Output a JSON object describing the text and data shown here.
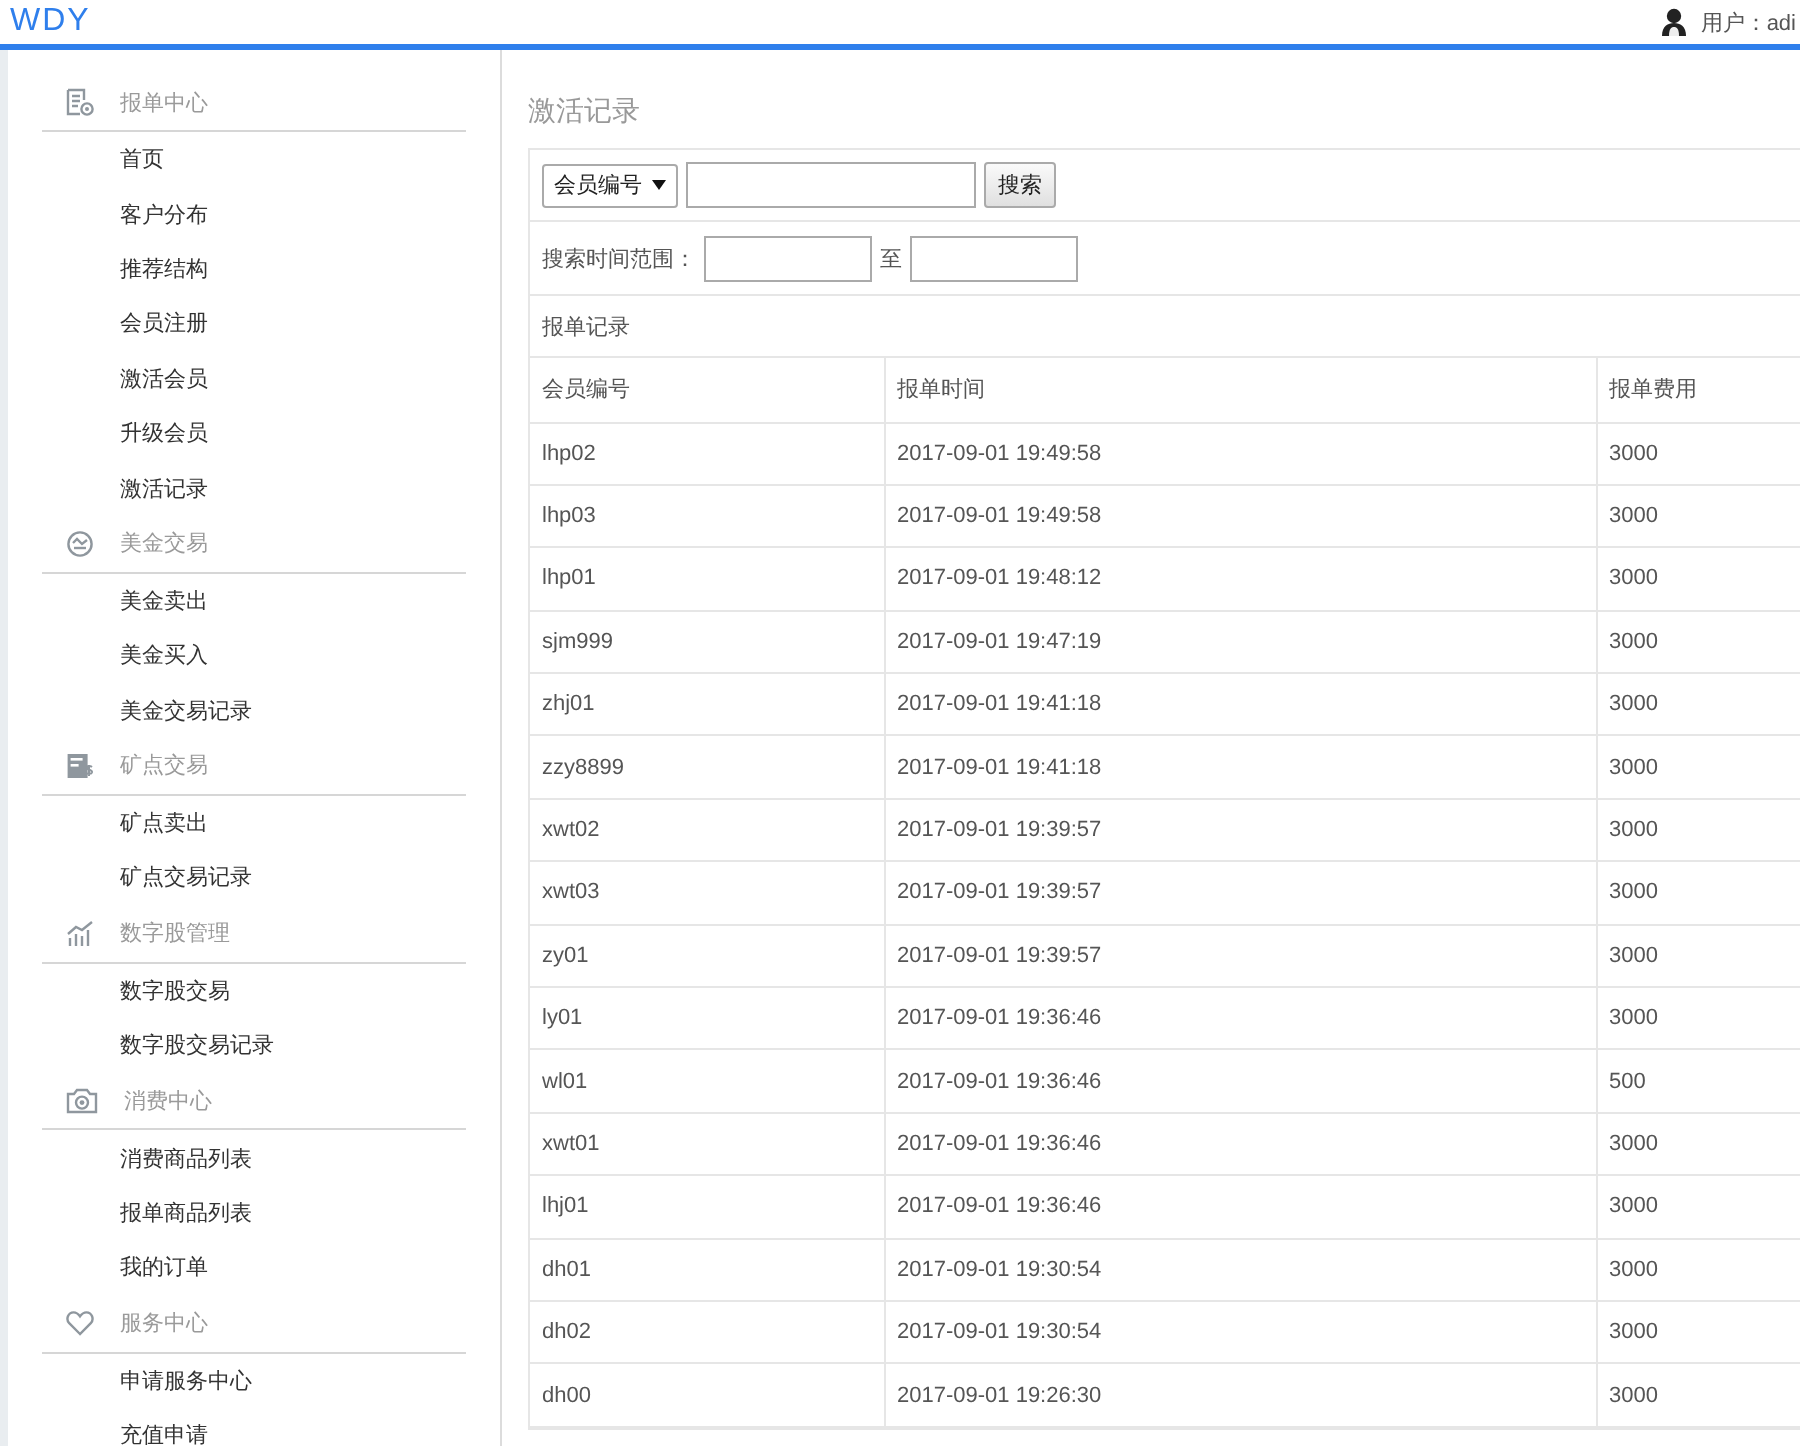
{
  "header": {
    "logo": "WDY",
    "user": "用户：adi"
  },
  "sidebar": {
    "sections": [
      {
        "kind": "report",
        "title": "报单中心",
        "items": [
          "首页",
          "客户分布",
          "推荐结构",
          "会员注册",
          "激活会员",
          "升级会员",
          "激活记录"
        ]
      },
      {
        "kind": "exchange",
        "title": "美金交易",
        "items": [
          "美金卖出",
          "美金买入",
          "美金交易记录"
        ]
      },
      {
        "kind": "mining",
        "title": "矿点交易",
        "items": [
          "矿点卖出",
          "矿点交易记录"
        ]
      },
      {
        "kind": "stock",
        "title": "数字股管理",
        "items": [
          "数字股交易",
          "数字股交易记录"
        ]
      },
      {
        "kind": "consume",
        "title": "消费中心",
        "items": [
          "消费商品列表",
          "报单商品列表",
          "我的订单"
        ]
      },
      {
        "kind": "service",
        "title": "服务中心",
        "items": [
          "申请服务中心",
          "充值申请"
        ]
      }
    ]
  },
  "page_title": "激活记录",
  "search": {
    "field": "会员编号",
    "button": "搜索"
  },
  "time_range": {
    "label": "搜索时间范围：",
    "separator": "至"
  },
  "table": {
    "caption": "报单记录",
    "columns": [
      "会员编号",
      "报单时间",
      "报单费用"
    ],
    "rows": [
      [
        "lhp02",
        "2017-09-01 19:49:58",
        "3000"
      ],
      [
        "lhp03",
        "2017-09-01 19:49:58",
        "3000"
      ],
      [
        "lhp01",
        "2017-09-01 19:48:12",
        "3000"
      ],
      [
        "sjm999",
        "2017-09-01 19:47:19",
        "3000"
      ],
      [
        "zhj01",
        "2017-09-01 19:41:18",
        "3000"
      ],
      [
        "zzy8899",
        "2017-09-01 19:41:18",
        "3000"
      ],
      [
        "xwt02",
        "2017-09-01 19:39:57",
        "3000"
      ],
      [
        "xwt03",
        "2017-09-01 19:39:57",
        "3000"
      ],
      [
        "zy01",
        "2017-09-01 19:39:57",
        "3000"
      ],
      [
        "ly01",
        "2017-09-01 19:36:46",
        "3000"
      ],
      [
        "wl01",
        "2017-09-01 19:36:46",
        "500"
      ],
      [
        "xwt01",
        "2017-09-01 19:36:46",
        "3000"
      ],
      [
        "lhj01",
        "2017-09-01 19:36:46",
        "3000"
      ],
      [
        "dh01",
        "2017-09-01 19:30:54",
        "3000"
      ],
      [
        "dh02",
        "2017-09-01 19:30:54",
        "3000"
      ],
      [
        "dh00",
        "2017-09-01 19:26:30",
        "3000"
      ]
    ]
  }
}
